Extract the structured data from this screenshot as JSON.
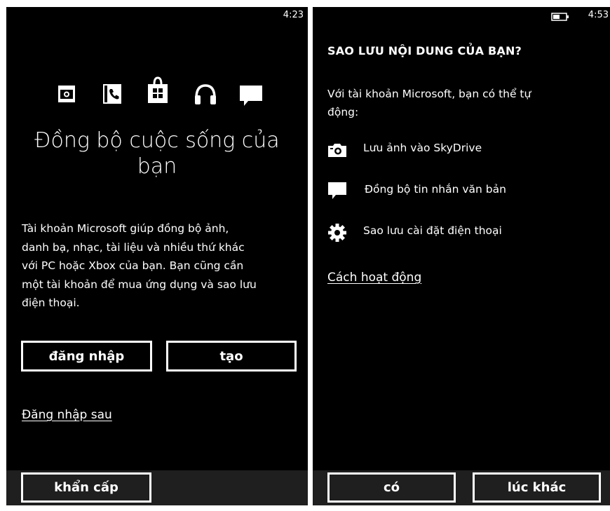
{
  "left_screen": {
    "status_time": "4:23",
    "icons": [
      "camera-icon",
      "phone-icon",
      "store-icon",
      "headphones-icon",
      "messaging-icon"
    ],
    "title_line1": "Đồng bộ cuộc sống của",
    "title_line2": "bạn",
    "description_lines": [
      "Tài khoản Microsoft giúp đồng bộ ảnh,",
      "danh bạ, nhạc, tài liệu và nhiều thứ khác",
      "với PC hoặc Xbox của bạn. Bạn cũng cần",
      "một tài khoản để mua ứng dụng và sao lưu",
      "điện thoại."
    ],
    "signin_button": "đăng nhập",
    "create_button": "tạo",
    "signin_later_link": "Đăng nhập sau",
    "emergency_button": "khẩn cấp"
  },
  "right_screen": {
    "status_time": "4:53",
    "battery_icon": "battery-icon",
    "title": "SAO LƯU NỘI DUNG CỦA BẠN?",
    "intro_line1": "Với tài khoản Microsoft, bạn có thể tự",
    "intro_line2": "động:",
    "features": [
      {
        "icon": "camera-icon",
        "label": "Lưu ảnh vào SkyDrive"
      },
      {
        "icon": "messaging-icon",
        "label": "Đồng bộ tin nhắn văn bản"
      },
      {
        "icon": "gear-icon",
        "label": "Sao lưu cài đặt điện thoại"
      }
    ],
    "how_it_works_link": "Cách hoạt động",
    "yes_button": "có",
    "later_button": "lúc khác"
  },
  "colors": {
    "background": "#000000",
    "app_bar": "#1f1f1f",
    "foreground": "#ffffff"
  }
}
